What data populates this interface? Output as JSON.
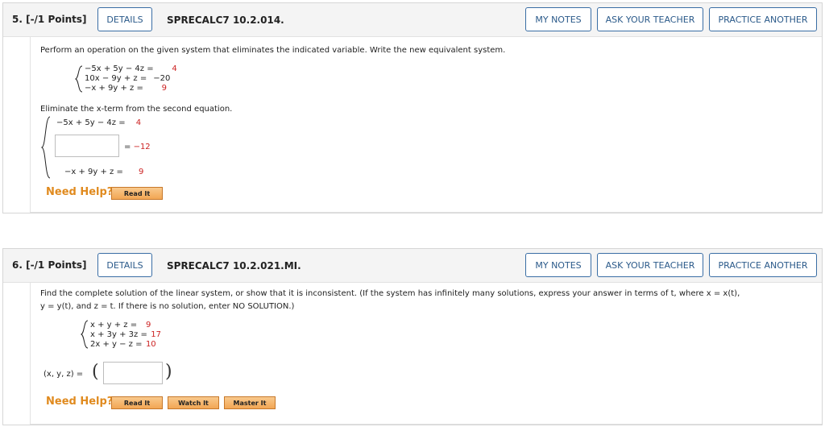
{
  "questions": [
    {
      "number": "5.  [-/1 Points]",
      "details_label": "DETAILS",
      "id": "SPRECALC7 10.2.014.",
      "my_notes_label": "MY NOTES",
      "ask_teacher_label": "ASK YOUR TEACHER",
      "practice_label": "PRACTICE ANOTHER",
      "prompt": "Perform an operation on the given system that eliminates the indicated variable. Write the new equivalent system.",
      "system": [
        {
          "lhs": "−5x + 5y − 4z =",
          "rhs": "4"
        },
        {
          "lhs": "10x − 9y +  z =",
          "rhs": "−20"
        },
        {
          "lhs": "−x + 9y +  z =",
          "rhs": "9"
        }
      ],
      "instruction": "Eliminate the x-term from the second equation.",
      "new_system": {
        "row1_lhs": "−5x + 5y − 4z =",
        "row1_rhs": "4",
        "row2_eq": "= ",
        "row2_rhs": "−12",
        "row3_lhs": "−x + 9y +  z =",
        "row3_rhs": "9"
      },
      "need_help": "Need Help?",
      "help_buttons": [
        "Read It"
      ]
    },
    {
      "number": "6.  [-/1 Points]",
      "details_label": "DETAILS",
      "id": "SPRECALC7 10.2.021.MI.",
      "my_notes_label": "MY NOTES",
      "ask_teacher_label": "ASK YOUR TEACHER",
      "practice_label": "PRACTICE ANOTHER",
      "prompt_line1": "Find the complete solution of the linear system, or show that it is inconsistent. (If the system has infinitely many solutions, express your answer in terms of t, where  x = x(t),",
      "prompt_line2": "y = y(t),  and  z = t.  If there is no solution, enter NO SOLUTION.)",
      "system": [
        {
          "lhs": " x +  y +  z =",
          "rhs": "9"
        },
        {
          "lhs": " x + 3y + 3z =",
          "rhs": "17"
        },
        {
          "lhs": "2x +  y −  z =",
          "rhs": "10"
        }
      ],
      "answer_label": "(x, y, z) =",
      "need_help": "Need Help?",
      "help_buttons": [
        "Read It",
        "Watch It",
        "Master It"
      ]
    }
  ]
}
